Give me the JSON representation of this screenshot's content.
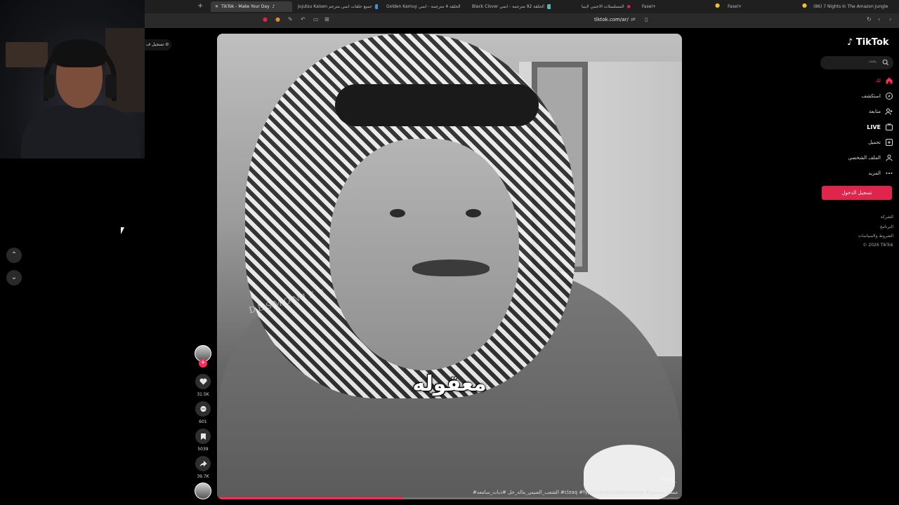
{
  "browser": {
    "tabs": [
      {
        "title": "TikTok - Make Your Day",
        "active": true
      },
      {
        "title": "Jujutsu Kaisen جميع حلقات انمي مترجم",
        "active": false
      },
      {
        "title": "Golden Kamuy الحلقة 4 مترجمة - انمي",
        "active": false
      },
      {
        "title": "Black Clover الحلقة 92 مترجمة - انمي",
        "active": false
      },
      {
        "title": "المسلسلات الاجنبي لاينبا",
        "active": false
      },
      {
        "title": "Fasel+",
        "active": false
      },
      {
        "title": "Fasel+",
        "active": false
      },
      {
        "title": "(86) 7 Nights In The Amazon Jungle",
        "active": false
      }
    ],
    "url": "tiktok.com/ar/",
    "colors": {
      "tabbar": "#1f1f1f",
      "toolbar": "#2a2a2a"
    }
  },
  "left": {
    "log_button": "تسجيل ف",
    "nav_up_icon": "chevron-up-icon",
    "nav_down_icon": "chevron-down-icon"
  },
  "video": {
    "caption": "معقوله",
    "watermark": "DESMON1S™",
    "handle": "clzaq_",
    "hashtags": "#الشعب_الصيني_ماله_حل #ذبات_سامعه #clzaq #fypppppppppppppppppp #مستر_سمسم",
    "progress": 0.4
  },
  "actions": {
    "likes": "31.5K",
    "comments": "601",
    "saves": "5039",
    "shares": "39.7K"
  },
  "sidebar": {
    "logo": "TikTok",
    "search_placeholder": "بحث",
    "items": [
      {
        "label": "لك",
        "icon": "home-icon",
        "active": true
      },
      {
        "label": "استكشف",
        "icon": "compass-icon",
        "active": false
      },
      {
        "label": "متابعة",
        "icon": "user-follow-icon",
        "active": false
      },
      {
        "label": "LIVE",
        "icon": "live-icon",
        "active": false
      },
      {
        "label": "تحميل",
        "icon": "upload-icon",
        "active": false
      },
      {
        "label": "الملف الشخصي",
        "icon": "profile-icon",
        "active": false
      },
      {
        "label": "المزيد",
        "icon": "more-icon",
        "active": false
      }
    ],
    "login_label": "تسجيل الدخول",
    "footer": [
      "الشركة",
      "البرنامج",
      "الشروط والسياسات",
      "© 2026 TikTok"
    ],
    "accent": "#fe2c55"
  }
}
